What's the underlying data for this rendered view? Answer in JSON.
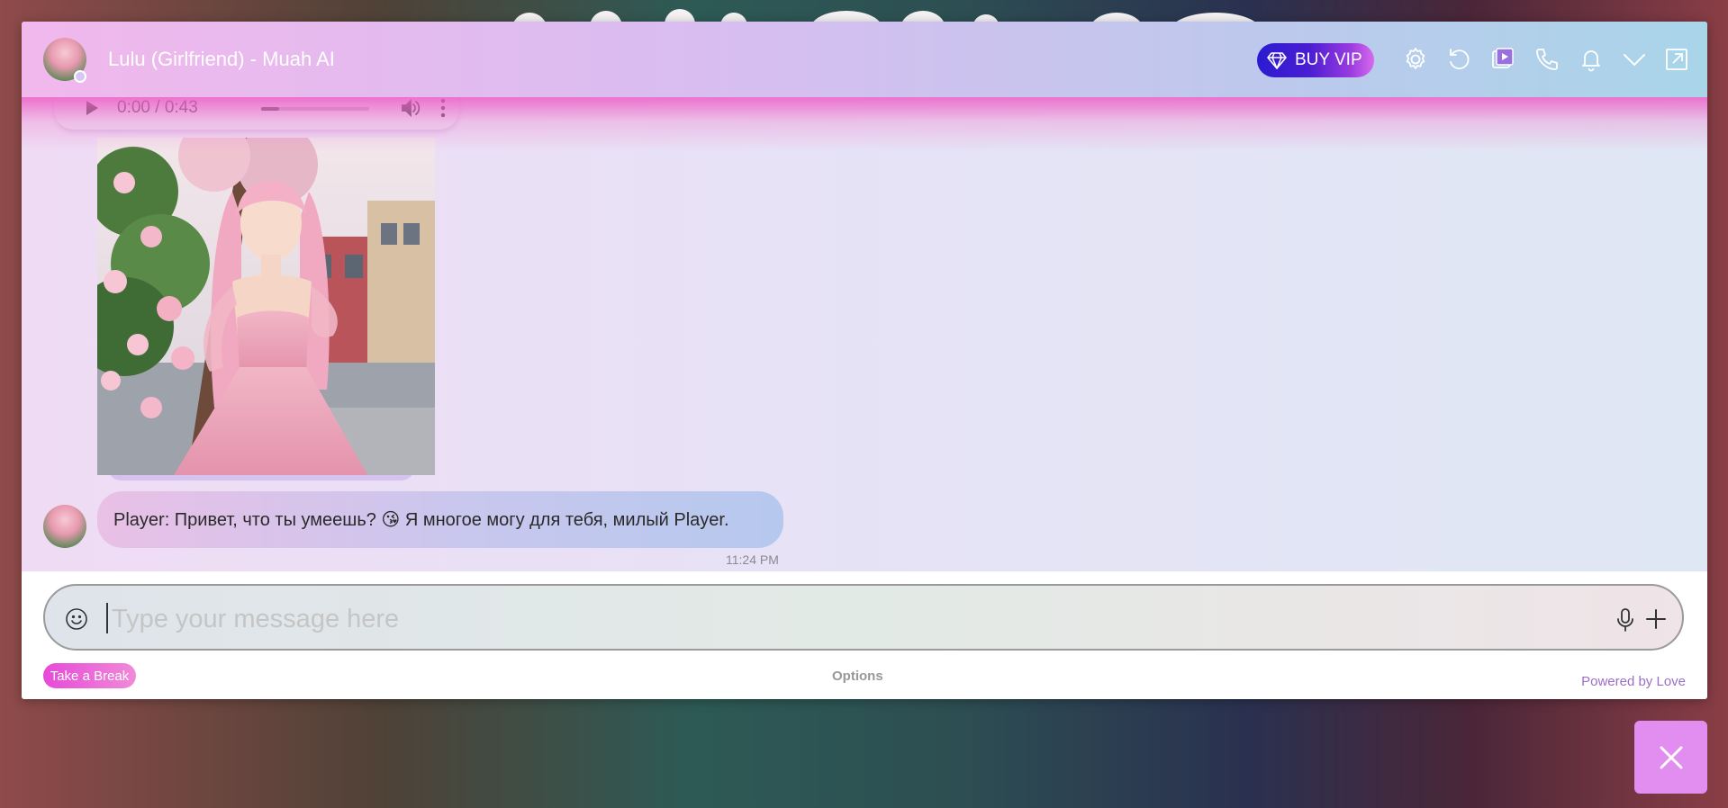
{
  "header": {
    "title": "Lulu (Girlfriend) - Muah AI",
    "buy_vip_label": "BUY VIP",
    "icons": [
      "gem-icon",
      "settings-icon",
      "refresh-icon",
      "video-icon",
      "phone-icon",
      "bell-icon",
      "chevron-down-icon",
      "external-link-icon"
    ]
  },
  "audio_player": {
    "time": "0:00 / 0:43",
    "progress_fraction": 0.17
  },
  "message": {
    "text": "Player: Привет, что ты умеешь? 😘 Я многое могу для тебя, милый Player.",
    "time": "11:24 PM"
  },
  "composer": {
    "placeholder": "Type your message here",
    "value": ""
  },
  "footer": {
    "take_break_label": "Take a Break",
    "options_label": "Options",
    "powered_label": "Powered by Love"
  },
  "colors": {
    "vip_gradient_start": "#2a1bd0",
    "break_button": "#e64ad8",
    "close_button": "#e28ef0",
    "powered_text": "#9b6fc7"
  }
}
